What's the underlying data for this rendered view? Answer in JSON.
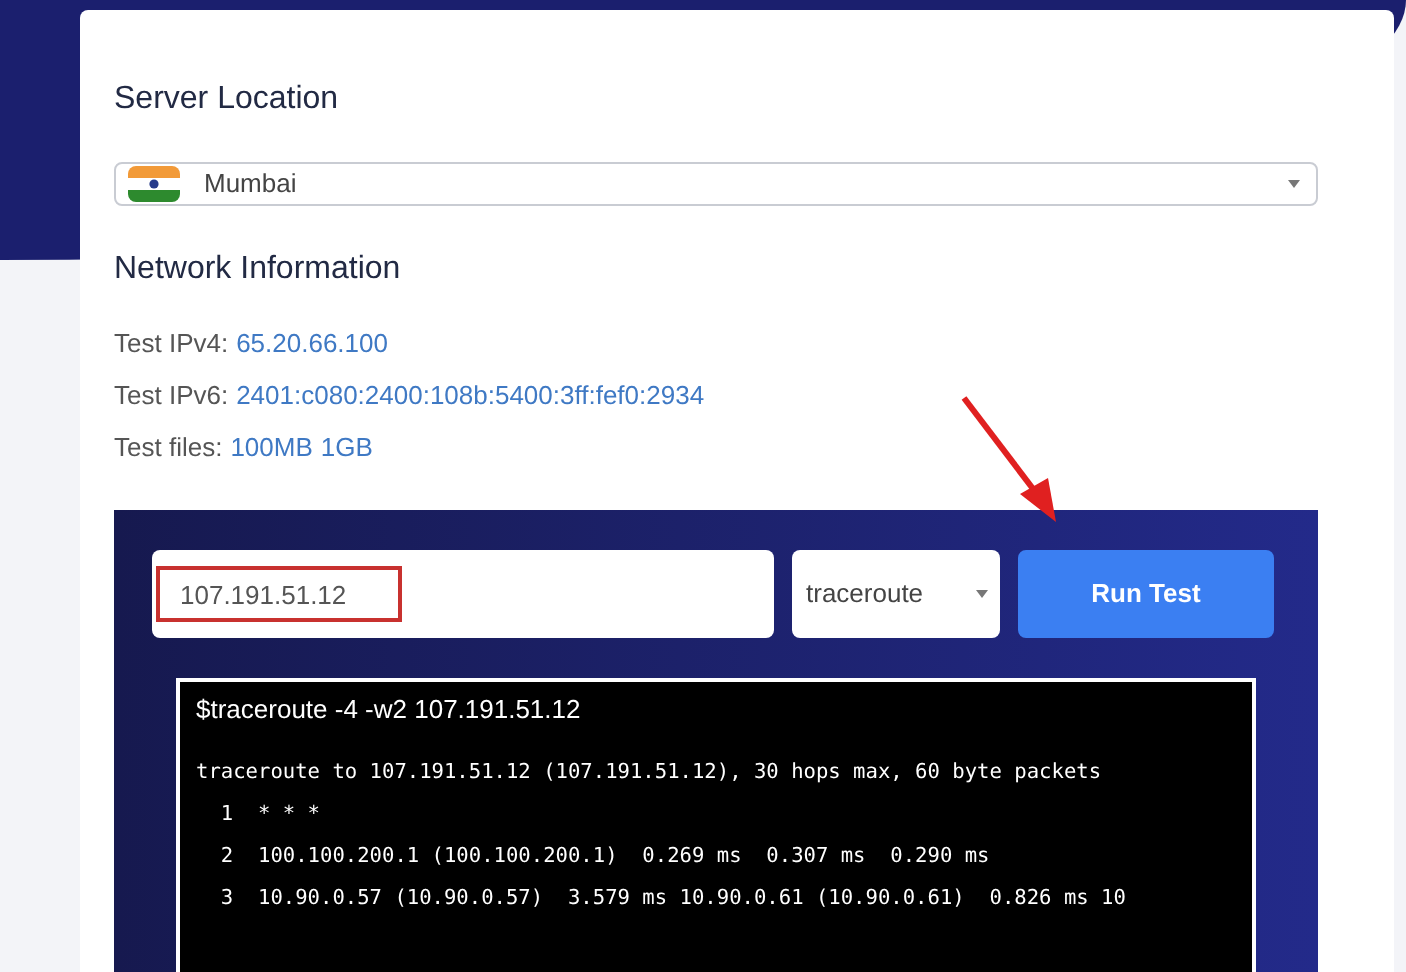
{
  "server_location": {
    "heading": "Server Location",
    "selected": "Mumbai"
  },
  "network_information": {
    "heading": "Network Information",
    "rows": [
      {
        "label": "Test IPv4:",
        "links": [
          "65.20.66.100"
        ]
      },
      {
        "label": "Test IPv6:",
        "links": [
          "2401:c080:2400:108b:5400:3ff:fef0:2934"
        ]
      },
      {
        "label": "Test files:",
        "links": [
          "100MB",
          "1GB"
        ]
      }
    ]
  },
  "test_panel": {
    "host_value": "107.191.51.12",
    "method": "traceroute",
    "run_button": "Run Test",
    "terminal": {
      "command": "$traceroute -4 -w2 107.191.51.12",
      "lines": [
        "traceroute to 107.191.51.12 (107.191.51.12), 30 hops max, 60 byte packets",
        "  1  * * *",
        "  2  100.100.200.1 (100.100.200.1)  0.269 ms  0.307 ms  0.290 ms",
        "  3  10.90.0.57 (10.90.0.57)  3.579 ms 10.90.0.61 (10.90.0.61)  0.826 ms 10"
      ]
    }
  }
}
